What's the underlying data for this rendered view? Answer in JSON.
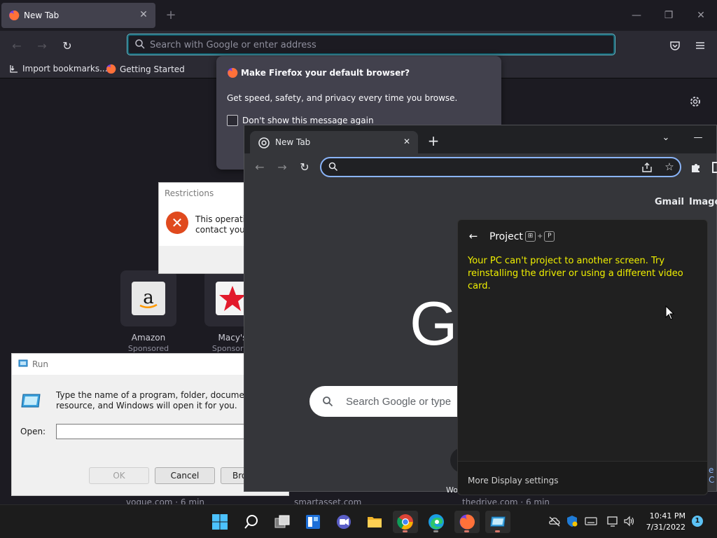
{
  "firefox": {
    "tab_title": "New Tab",
    "url_placeholder": "Search with Google or enter address",
    "bookmarks": [
      "Import bookmarks...",
      "Getting Started"
    ],
    "tiles": [
      {
        "label": "Amazon",
        "sub": "Sponsored"
      },
      {
        "label": "Macy's",
        "sub": "Sponsored"
      }
    ],
    "bottom_sites": [
      "vogue.com · 6 min",
      "smartasset.com",
      "thedrive.com · 6 min"
    ],
    "popup": {
      "title": "Make Firefox your default browser?",
      "body": "Get speed, safety, and privacy every time you browse.",
      "checkbox": "Don't show this message again"
    }
  },
  "restrictions": {
    "title": "Restrictions",
    "message_line1": "This operation",
    "message_line2": "contact your"
  },
  "run": {
    "title": "Run",
    "desc_line1": "Type the name of a program, folder, document, or I",
    "desc_line2": "resource, and Windows will open it for you.",
    "open_label": "Open:",
    "ok": "OK",
    "cancel": "Cancel",
    "browse": "Bro"
  },
  "chrome": {
    "tab_title": "New Tab",
    "links": [
      "Gmail",
      "Images"
    ],
    "logo": "G",
    "search_placeholder": "Search Google or type",
    "shortcut_label": "Wo"
  },
  "project": {
    "title": "Project",
    "shortcut": [
      "⊞",
      "+",
      "P"
    ],
    "message": "Your PC can't project to another screen. Try reinstalling the driver or using a different video card.",
    "footer": "More Display settings"
  },
  "edge_peek": "e C",
  "taskbar": {
    "time": "10:41 PM",
    "date": "7/31/2022",
    "notifications": "1"
  }
}
